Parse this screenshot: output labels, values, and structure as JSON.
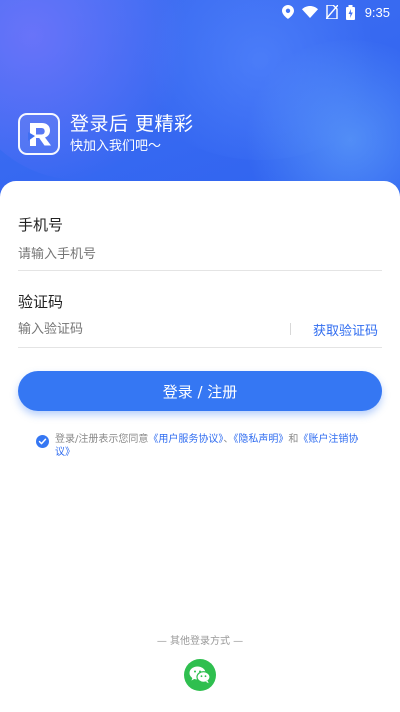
{
  "status_bar": {
    "time": "9:35",
    "icons": [
      "location-icon",
      "wifi-icon",
      "no-sim-icon",
      "battery-icon"
    ]
  },
  "header": {
    "logo_icon": "r-logo-icon",
    "title": "登录后 更精彩",
    "subtitle": "快加入我们吧～"
  },
  "form": {
    "phone_label": "手机号",
    "phone_placeholder": "请输入手机号",
    "code_label": "验证码",
    "code_placeholder": "输入验证码",
    "get_code": "获取验证码",
    "submit": "登录 / 注册"
  },
  "agreement": {
    "checked": true,
    "prefix": "登录/注册表示您同意",
    "user_agreement": "《用户服务协议》",
    "sep1": "、",
    "privacy": "《隐私声明》",
    "sep2": "和",
    "cancel_agreement": "《账户注销协议》"
  },
  "other_login": {
    "label": "— 其他登录方式 —",
    "methods": [
      "wechat-icon"
    ]
  },
  "colors": {
    "primary": "#3577f3",
    "link": "#2f6cf0",
    "wechat": "#2fbf4f"
  }
}
